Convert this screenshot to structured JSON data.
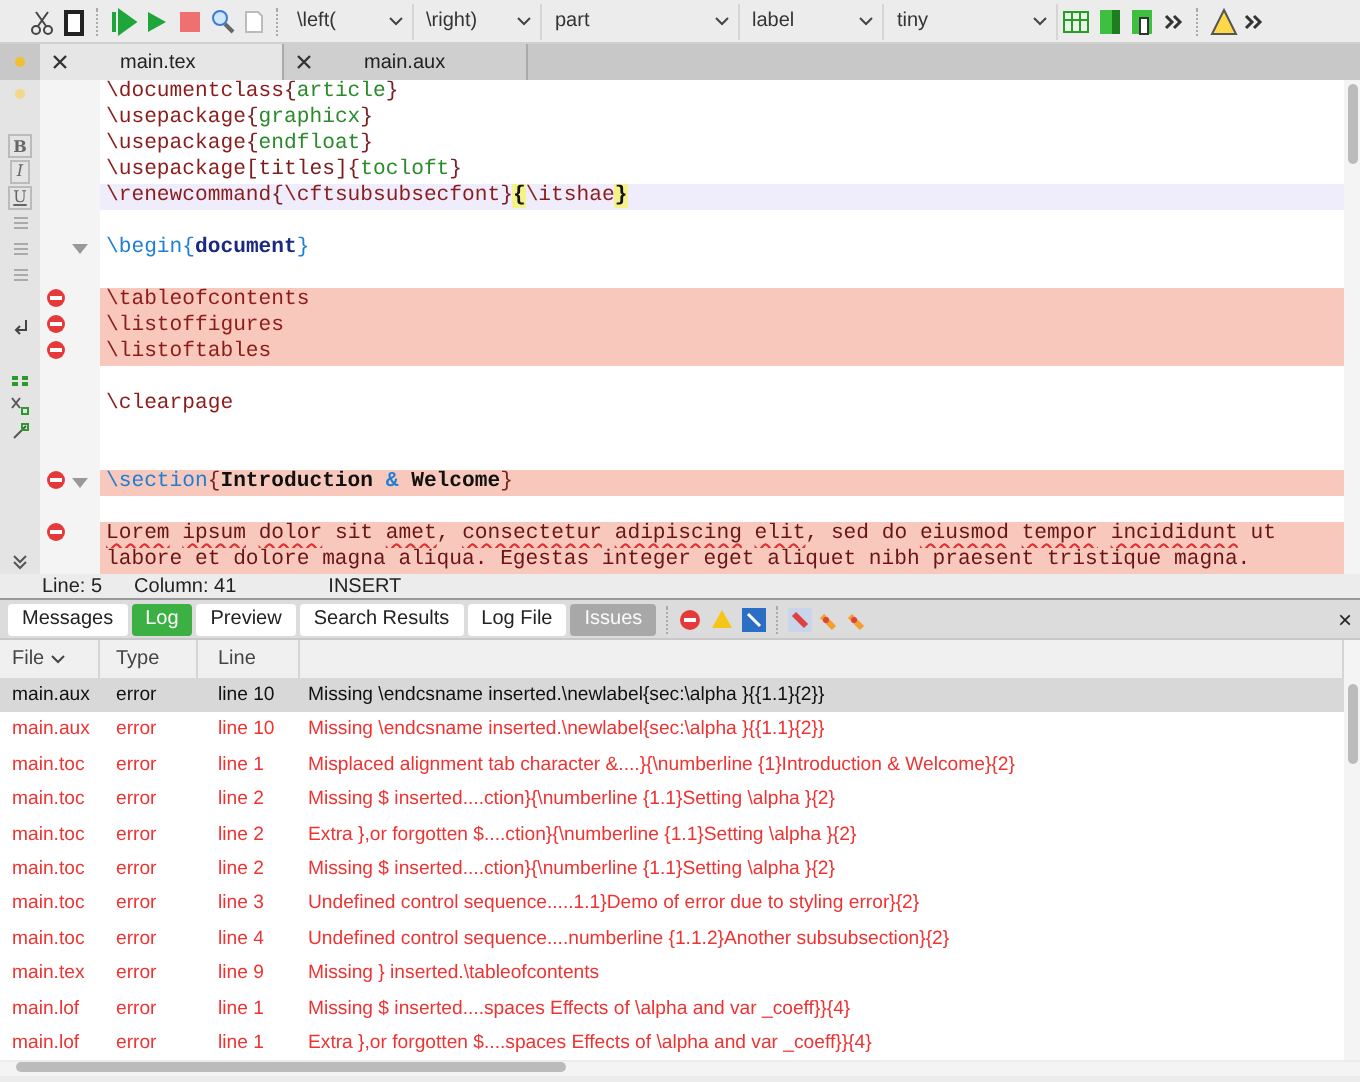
{
  "toolbar": {
    "dropdowns": [
      "\\left(",
      "\\right)",
      "part",
      "label",
      "tiny"
    ]
  },
  "tabs": [
    {
      "label": "main.tex",
      "selected": true
    },
    {
      "label": "main.aux",
      "selected": false
    }
  ],
  "format_bar": [
    "B",
    "I",
    "U"
  ],
  "editor": {
    "lines": [
      {
        "kind": "code",
        "error": false,
        "current": false,
        "marker": false,
        "fold": false,
        "segments": [
          {
            "text": "\\documentclass",
            "kind": "command"
          },
          {
            "text": "{",
            "kind": "brace"
          },
          {
            "text": "article",
            "kind": "arg"
          },
          {
            "text": "}",
            "kind": "brace"
          }
        ]
      },
      {
        "kind": "code",
        "error": false,
        "current": false,
        "marker": false,
        "fold": false,
        "segments": [
          {
            "text": "\\usepackage",
            "kind": "command"
          },
          {
            "text": "{",
            "kind": "brace"
          },
          {
            "text": "graphicx",
            "kind": "arg"
          },
          {
            "text": "}",
            "kind": "brace"
          }
        ]
      },
      {
        "kind": "code",
        "error": false,
        "current": false,
        "marker": false,
        "fold": false,
        "segments": [
          {
            "text": "\\usepackage",
            "kind": "command"
          },
          {
            "text": "{",
            "kind": "brace"
          },
          {
            "text": "endfloat",
            "kind": "arg"
          },
          {
            "text": "}",
            "kind": "brace"
          }
        ]
      },
      {
        "kind": "code",
        "error": false,
        "current": false,
        "marker": false,
        "fold": false,
        "segments": [
          {
            "text": "\\usepackage",
            "kind": "command"
          },
          {
            "text": "[titles]{",
            "kind": "brace"
          },
          {
            "text": "tocloft",
            "kind": "arg"
          },
          {
            "text": "}",
            "kind": "brace"
          }
        ]
      },
      {
        "kind": "code",
        "error": false,
        "current": true,
        "marker": false,
        "fold": false,
        "segments": [
          {
            "text": "\\renewcommand",
            "kind": "command"
          },
          {
            "text": "{",
            "kind": "brace"
          },
          {
            "text": "\\cftsubsubsecfont",
            "kind": "command"
          },
          {
            "text": "}",
            "kind": "brace"
          },
          {
            "text": "{",
            "kind": "matched"
          },
          {
            "text": "\\itshae",
            "kind": "command"
          },
          {
            "text": "}",
            "kind": "matched"
          }
        ]
      },
      {
        "kind": "blank"
      },
      {
        "kind": "code",
        "error": false,
        "current": false,
        "marker": false,
        "fold": true,
        "segments": [
          {
            "text": "\\begin{",
            "kind": "env"
          },
          {
            "text": "document",
            "kind": "envname"
          },
          {
            "text": "}",
            "kind": "env"
          }
        ]
      },
      {
        "kind": "blank"
      },
      {
        "kind": "code",
        "error": true,
        "current": false,
        "marker": true,
        "fold": false,
        "segments": [
          {
            "text": "\\tableofcontents",
            "kind": "command"
          }
        ]
      },
      {
        "kind": "code",
        "error": true,
        "current": false,
        "marker": true,
        "fold": false,
        "segments": [
          {
            "text": "\\listoffigures",
            "kind": "command"
          }
        ]
      },
      {
        "kind": "code",
        "error": true,
        "current": false,
        "marker": true,
        "fold": false,
        "segments": [
          {
            "text": "\\listoftables",
            "kind": "command"
          }
        ]
      },
      {
        "kind": "blank"
      },
      {
        "kind": "code",
        "error": false,
        "current": false,
        "marker": false,
        "fold": false,
        "segments": [
          {
            "text": "\\clearpage",
            "kind": "command"
          }
        ]
      },
      {
        "kind": "blank"
      },
      {
        "kind": "blank"
      },
      {
        "kind": "code",
        "error": true,
        "current": false,
        "marker": true,
        "fold": true,
        "segments": [
          {
            "text": "\\section",
            "kind": "env"
          },
          {
            "text": "{",
            "kind": "brace"
          },
          {
            "text": "Introduction ",
            "kind": "title"
          },
          {
            "text": "&",
            "kind": "special"
          },
          {
            "text": " Welcome",
            "kind": "title"
          },
          {
            "text": "}",
            "kind": "brace"
          }
        ]
      },
      {
        "kind": "blank"
      },
      {
        "kind": "code",
        "error": true,
        "current": false,
        "marker": true,
        "fold": false,
        "segments": [
          {
            "text": "Lorem ",
            "kind": "misspelled"
          },
          {
            "text": "ipsum ",
            "kind": "misspelled"
          },
          {
            "text": "dolor",
            "kind": "misspelled"
          },
          {
            "text": " sit ",
            "kind": "text"
          },
          {
            "text": "amet",
            "kind": "misspelled"
          },
          {
            "text": ", ",
            "kind": "text"
          },
          {
            "text": "consectetur ",
            "kind": "misspelled"
          },
          {
            "text": "adipiscing ",
            "kind": "misspelled"
          },
          {
            "text": "elit",
            "kind": "misspelled"
          },
          {
            "text": ", sed do ",
            "kind": "text"
          },
          {
            "text": "eiusmod ",
            "kind": "misspelled"
          },
          {
            "text": "tempor ",
            "kind": "misspelled"
          },
          {
            "text": "incididunt",
            "kind": "misspelled"
          },
          {
            "text": " ut",
            "kind": "text"
          }
        ]
      },
      {
        "kind": "code",
        "error": true,
        "current": false,
        "marker": false,
        "fold": false,
        "segments": [
          {
            "text": "labore et dolore magna aliqua. Egestas integer eget aliquet nibh praesent tristique magna.",
            "kind": "text"
          }
        ]
      }
    ]
  },
  "status_bar": {
    "line": "Line: 5",
    "column": "Column: 41",
    "mode": "INSERT"
  },
  "panel": {
    "tabs": [
      {
        "label": "Messages",
        "selected": false,
        "disabled": false
      },
      {
        "label": "Log",
        "selected": true,
        "disabled": false
      },
      {
        "label": "Preview",
        "selected": false,
        "disabled": false
      },
      {
        "label": "Search Results",
        "selected": false,
        "disabled": false
      },
      {
        "label": "Log File",
        "selected": false,
        "disabled": false
      },
      {
        "label": "Issues",
        "selected": false,
        "disabled": true
      }
    ],
    "close": "×",
    "table": {
      "columns": [
        "File",
        "Type",
        "Line"
      ],
      "rows": [
        {
          "file": "main.aux",
          "type": "error",
          "line": "line 10",
          "message": "Missing \\endcsname inserted.\\newlabel{sec:\\alpha }{{1.1}{2}}",
          "selected": true
        },
        {
          "file": "main.aux",
          "type": "error",
          "line": "line 10",
          "message": "Missing \\endcsname inserted.\\newlabel{sec:\\alpha }{{1.1}{2}}",
          "selected": false
        },
        {
          "file": "main.toc",
          "type": "error",
          "line": "line 1",
          "message": "Misplaced alignment tab character &....}{\\numberline {1}Introduction & Welcome}{2}",
          "selected": false
        },
        {
          "file": "main.toc",
          "type": "error",
          "line": "line 2",
          "message": "Missing $ inserted....ction}{\\numberline {1.1}Setting \\alpha }{2}",
          "selected": false
        },
        {
          "file": "main.toc",
          "type": "error",
          "line": "line 2",
          "message": "Extra },or forgotten $....ction}{\\numberline {1.1}Setting \\alpha }{2}",
          "selected": false
        },
        {
          "file": "main.toc",
          "type": "error",
          "line": "line 2",
          "message": "Missing $ inserted....ction}{\\numberline {1.1}Setting \\alpha }{2}",
          "selected": false
        },
        {
          "file": "main.toc",
          "type": "error",
          "line": "line 3",
          "message": "Undefined control sequence.....1.1}Demo of error due to styling error}{2}",
          "selected": false
        },
        {
          "file": "main.toc",
          "type": "error",
          "line": "line 4",
          "message": "Undefined control sequence....numberline {1.1.2}Another subsubsection}{2}",
          "selected": false
        },
        {
          "file": "main.tex",
          "type": "error",
          "line": "line 9",
          "message": "Missing } inserted.\\tableofcontents",
          "selected": false
        },
        {
          "file": "main.lof",
          "type": "error",
          "line": "line 1",
          "message": "Missing $ inserted....spaces Effects of \\alpha and var _coeff}}{4}",
          "selected": false
        },
        {
          "file": "main.lof",
          "type": "error",
          "line": "line 1",
          "message": "Extra },or forgotten $....spaces Effects of \\alpha and var _coeff}}{4}",
          "selected": false
        }
      ]
    }
  }
}
